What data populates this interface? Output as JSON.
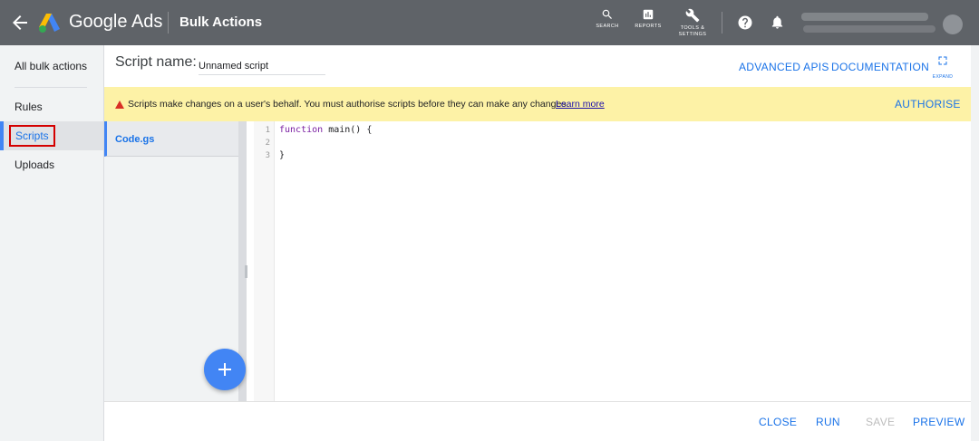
{
  "topbar": {
    "product_name": "Google Ads",
    "page_title": "Bulk Actions",
    "tools": {
      "search": "SEARCH",
      "reports": "REPORTS",
      "tools_line1": "TOOLS &",
      "tools_line2": "SETTINGS"
    }
  },
  "leftnav": {
    "items": [
      {
        "label": "All bulk actions"
      },
      {
        "label": "Rules"
      },
      {
        "label": "Scripts"
      },
      {
        "label": "Uploads"
      }
    ],
    "selected": "Scripts"
  },
  "header": {
    "script_label": "Script name:",
    "script_name_value": "Unnamed script",
    "advanced_apis": "ADVANCED APIS",
    "documentation": "DOCUMENTATION",
    "expand_label": "EXPAND"
  },
  "warning": {
    "text": "Scripts make changes on a user's behalf. You must authorise scripts before they can make any changes.",
    "learn_more": "Learn more",
    "authorise": "AUTHORISE"
  },
  "files": [
    {
      "name": "Code.gs"
    }
  ],
  "editor": {
    "line_numbers": [
      "1",
      "2",
      "3"
    ],
    "lines": [
      {
        "keyword": "function",
        "rest": " main() {"
      },
      {
        "keyword": "",
        "rest": ""
      },
      {
        "keyword": "",
        "rest": "}"
      }
    ]
  },
  "footer": {
    "close": "CLOSE",
    "run": "RUN",
    "save": "SAVE",
    "preview": "PREVIEW"
  },
  "colors": {
    "topbar": "#5f6368",
    "accent": "#1a73e8",
    "warning_bg": "#fdf2a6",
    "selection_border": "#d40000"
  }
}
